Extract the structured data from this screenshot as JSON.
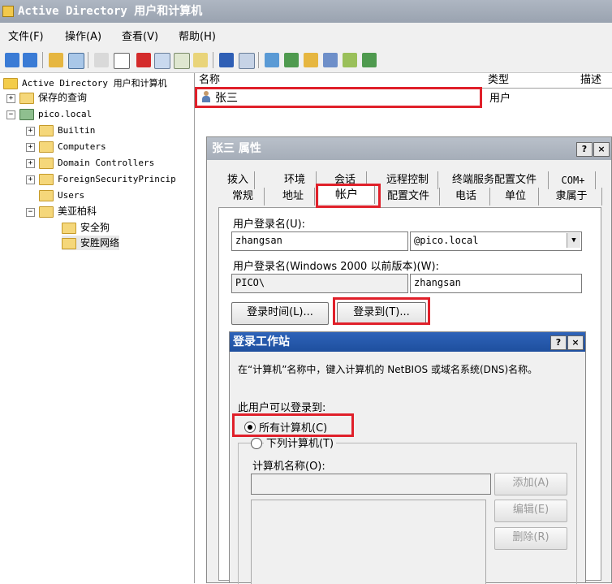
{
  "window": {
    "title": "Active Directory 用户和计算机"
  },
  "menu": [
    {
      "label": "文件(F)"
    },
    {
      "label": "操作(A)"
    },
    {
      "label": "查看(V)"
    },
    {
      "label": "帮助(H)"
    }
  ],
  "toolbar": {
    "icons": [
      "back-arrow-icon",
      "forward-arrow-icon",
      "folder-up-icon",
      "show-tree-icon",
      "cut-icon",
      "copy-icon",
      "delete-icon",
      "properties-icon",
      "refresh-icon",
      "export-icon",
      "help-icon",
      "console-icon",
      "new-user-icon",
      "new-group-icon",
      "new-ou-icon",
      "filter-icon",
      "find-icon",
      "add-to-group-icon"
    ]
  },
  "tree": {
    "root": "Active Directory 用户和计算机",
    "saved_queries": "保存的查询",
    "domain": "pico.local",
    "children": [
      "Builtin",
      "Computers",
      "Domain Controllers",
      "ForeignSecurityPrincip",
      "Users",
      "美亚柏科"
    ],
    "ou_children": [
      "安全狗",
      "安胜网络"
    ]
  },
  "list": {
    "columns": [
      "名称",
      "类型",
      "描述"
    ],
    "rows": [
      {
        "name": "张三",
        "type": "用户"
      }
    ]
  },
  "props": {
    "title": "张三 属性",
    "tabs_row1": [
      "拨入",
      "环境",
      "会话",
      "远程控制",
      "终端服务配置文件",
      "COM+"
    ],
    "tabs_row2": [
      "常规",
      "地址",
      "帐户",
      "配置文件",
      "电话",
      "单位",
      "隶属于"
    ],
    "logon_name_label": "用户登录名(U):",
    "logon_name": "zhangsan",
    "domain_suffix": "@pico.local",
    "pre2000_label": "用户登录名(Windows 2000 以前版本)(W):",
    "pre2000_domain": "PICO\\",
    "pre2000_name": "zhangsan",
    "logon_hours_btn": "登录时间(L)...",
    "logon_to_btn": "登录到(T)..."
  },
  "ws": {
    "title": "登录工作站",
    "instruction": "在“计算机”名称中，键入计算机的 NetBIOS 或域名系统(DNS)名称。",
    "can_logon_label": "此用户可以登录到:",
    "all_computers": "所有计算机(C)",
    "following_computers": "下列计算机(T)",
    "computer_name_label": "计算机名称(O):",
    "add_btn": "添加(A)",
    "edit_btn": "编辑(E)",
    "remove_btn": "删除(R)"
  }
}
